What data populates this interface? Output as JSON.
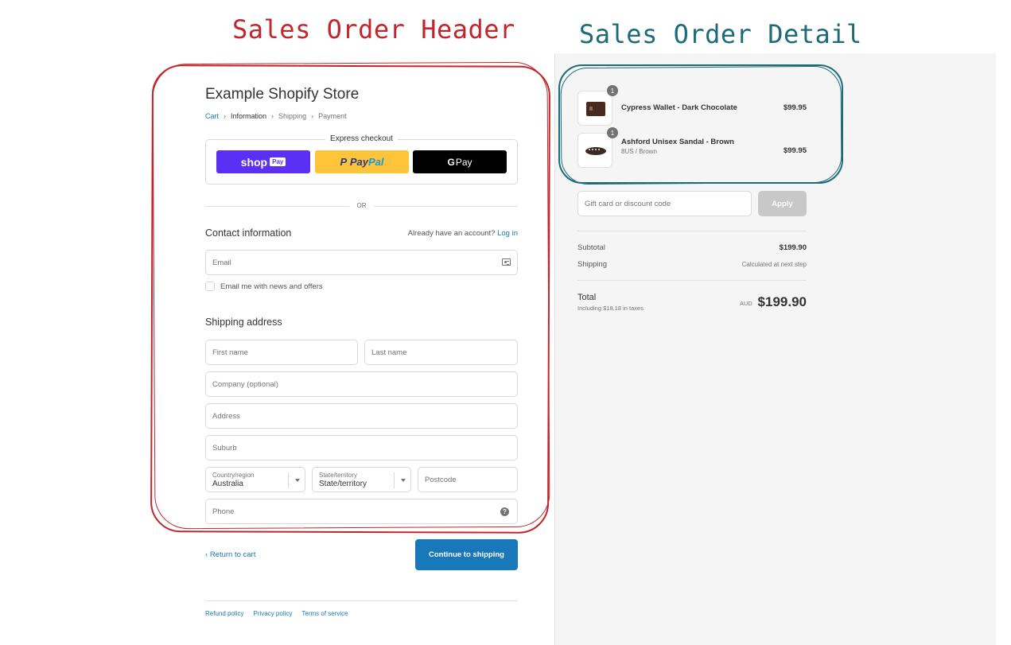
{
  "annotations": {
    "header_label": "Sales Order Header",
    "detail_label": "Sales Order Detail",
    "header_color": "#c0272d",
    "detail_color": "#1d6b78"
  },
  "store": {
    "name": "Example Shopify Store"
  },
  "breadcrumb": [
    "Cart",
    "Information",
    "Shipping",
    "Payment"
  ],
  "express": {
    "title": "Express checkout",
    "shop_pay": {
      "text": "shop",
      "chip": "Pay"
    },
    "paypal": {
      "text1": "Pay",
      "text2": "Pal"
    },
    "gpay": {
      "g": "G",
      "text": "Pay"
    },
    "or": "OR"
  },
  "contact": {
    "title": "Contact information",
    "account_prompt": "Already have an account?",
    "login": "Log in",
    "email_placeholder": "Email",
    "newsletter": "Email me with news and offers"
  },
  "shipping": {
    "title": "Shipping address",
    "first_name": "First name",
    "last_name": "Last name",
    "company": "Company (optional)",
    "address": "Address",
    "suburb": "Suburb",
    "country_label": "Country/region",
    "country_value": "Australia",
    "state_label": "State/territory",
    "state_value": "State/territory",
    "postcode": "Postcode",
    "phone": "Phone"
  },
  "actions": {
    "return": "Return to cart",
    "continue": "Continue to shipping"
  },
  "footer": [
    "Refund policy",
    "Privacy policy",
    "Terms of service"
  ],
  "order": {
    "items": [
      {
        "qty": "1",
        "name": "Cypress Wallet - Dark Chocolate",
        "variant": "",
        "price": "$99.95"
      },
      {
        "qty": "1",
        "name": "Ashford Unisex Sandal - Brown",
        "variant": "8US / Brown",
        "price": "$99.95"
      }
    ],
    "discount_placeholder": "Gift card or discount code",
    "apply": "Apply",
    "subtotal_label": "Subtotal",
    "subtotal_value": "$199.90",
    "shipping_label": "Shipping",
    "shipping_value": "Calculated at next step",
    "total_label": "Total",
    "tax_note": "Including $18.18 in taxes",
    "currency": "AUD",
    "total_value": "$199.90"
  },
  "colors": {
    "link": "#1878b9",
    "shop_pay": "#5a31f4",
    "paypal": "#ffc439",
    "primary_button": "#1878b9"
  }
}
